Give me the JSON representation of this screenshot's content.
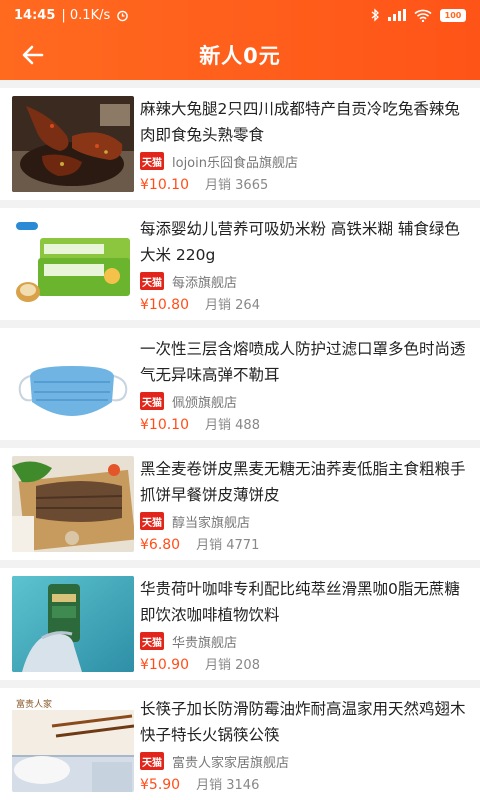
{
  "status": {
    "time": "14:45",
    "speed": "| 0.1K/s",
    "battery": "100"
  },
  "header": {
    "title": "新人0元"
  },
  "tmall_label": "天猫",
  "sales_prefix": "月销",
  "items": [
    {
      "name": "麻辣大兔腿2只四川成都特产自贡冷吃兔香辣兔肉即食兔头熟零食",
      "shop": "lojoin乐囧食品旗舰店",
      "price": "¥10.10",
      "sales": "3665"
    },
    {
      "name": "每添婴幼儿营养可吸奶米粉 高铁米糊 辅食绿色大米 220g",
      "shop": "每添旗舰店",
      "price": "¥10.80",
      "sales": "264"
    },
    {
      "name": "一次性三层含熔喷成人防护过滤口罩多色时尚透气无异味高弹不勒耳",
      "shop": "佩颁旗舰店",
      "price": "¥10.10",
      "sales": "488"
    },
    {
      "name": "黑全麦卷饼皮黑麦无糖无油荞麦低脂主食粗粮手抓饼早餐饼皮薄饼皮",
      "shop": "醇当家旗舰店",
      "price": "¥6.80",
      "sales": "4771"
    },
    {
      "name": "华贵荷叶咖啡专利配比纯萃丝滑黑咖0脂无蔗糖即饮浓咖啡植物饮料",
      "shop": "华贵旗舰店",
      "price": "¥10.90",
      "sales": "208"
    },
    {
      "name": "长筷子加长防滑防霉油炸耐高温家用天然鸡翅木快子特长火锅筷公筷",
      "shop": "富贵人家家居旗舰店",
      "price": "¥5.90",
      "sales": "3146"
    }
  ],
  "image_text": {
    "chopsticks_brand": "富贵人家"
  }
}
